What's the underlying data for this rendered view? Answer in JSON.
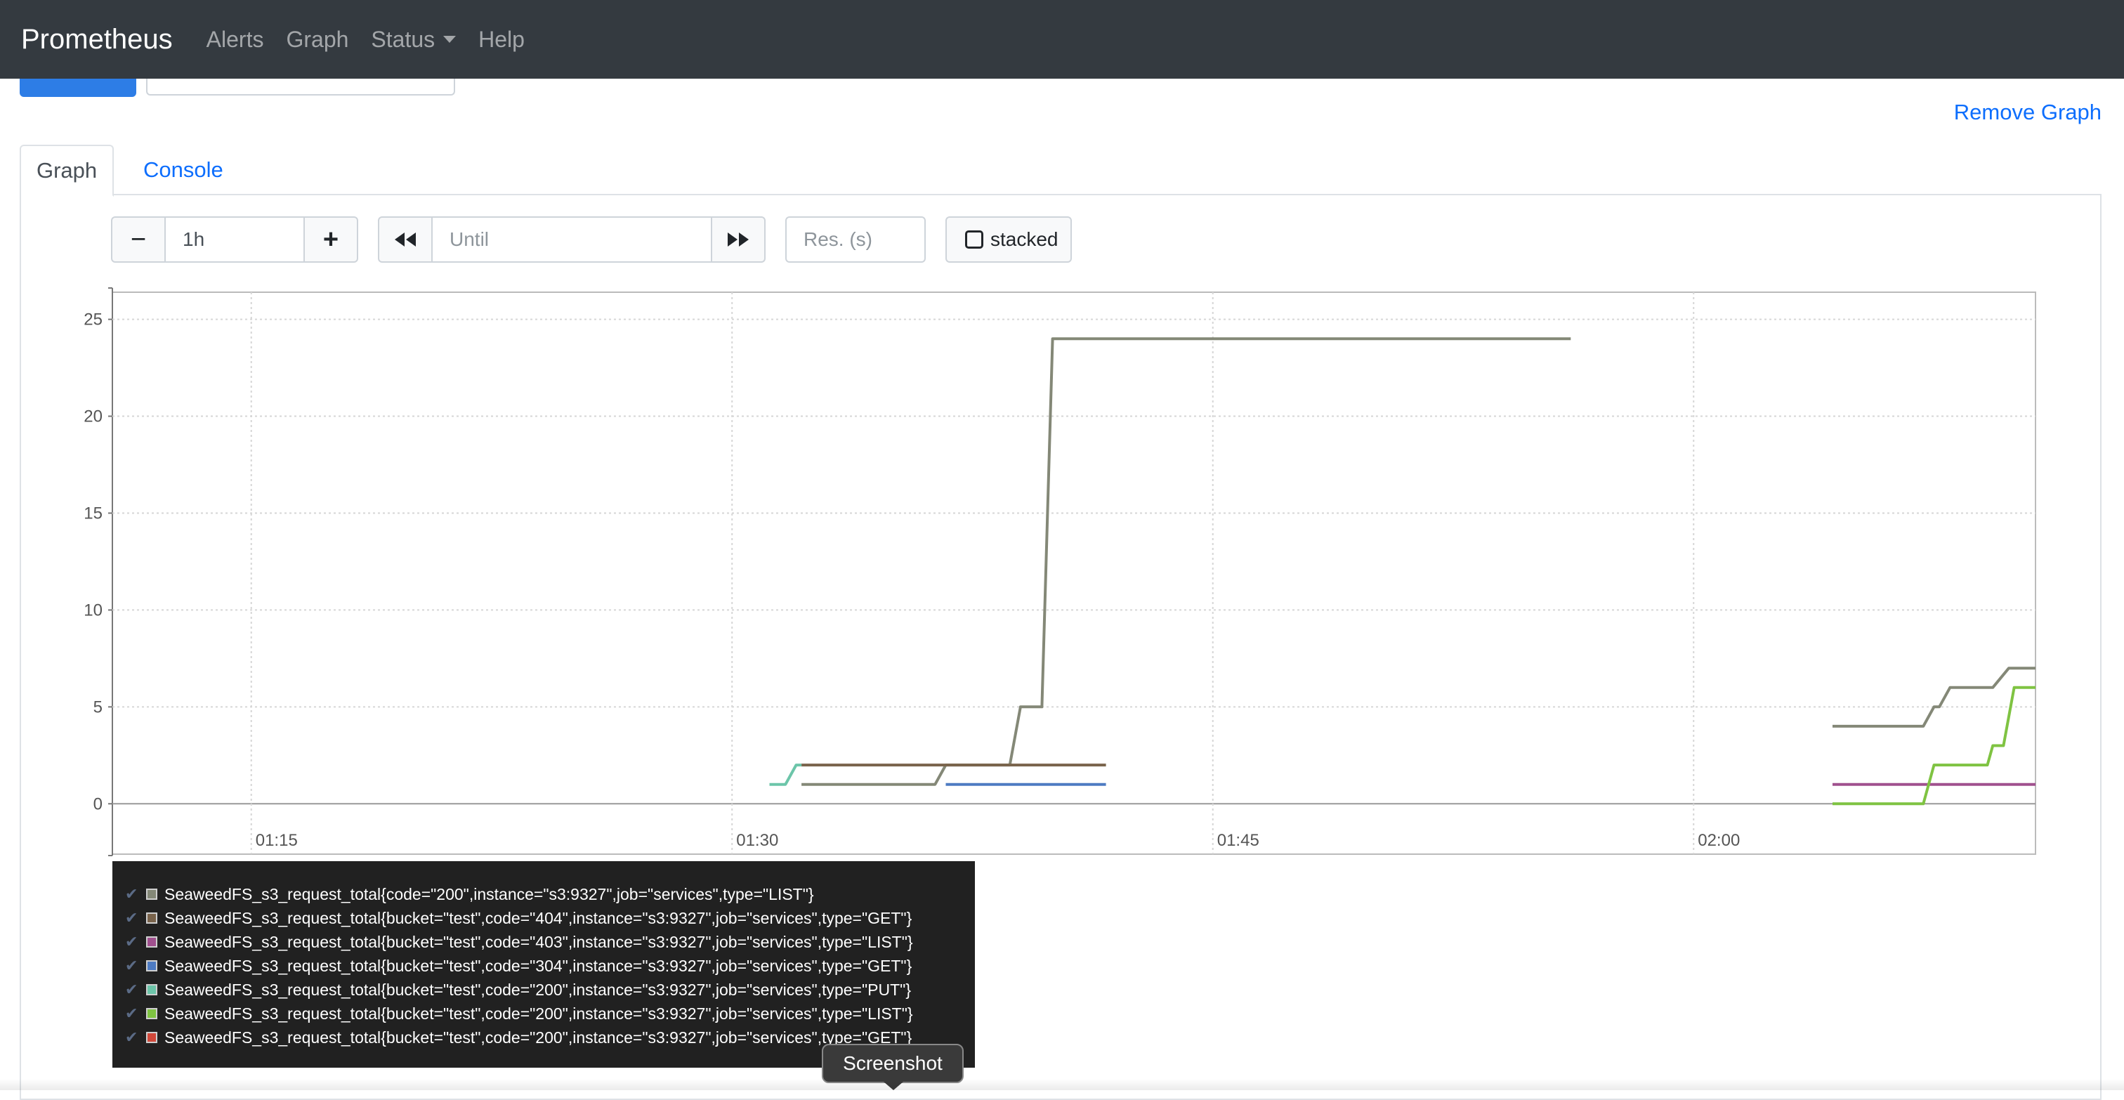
{
  "navbar": {
    "brand": "Prometheus",
    "items": [
      {
        "label": "Alerts"
      },
      {
        "label": "Graph"
      },
      {
        "label": "Status"
      },
      {
        "label": "Help"
      }
    ]
  },
  "panel": {
    "remove_graph": "Remove Graph",
    "tabs": [
      {
        "label": "Graph"
      },
      {
        "label": "Console"
      }
    ]
  },
  "controls": {
    "range_minus": "−",
    "range_value": "1h",
    "range_plus": "+",
    "back": "◀◀",
    "until_placeholder": "Until",
    "forward": "▶▶",
    "res_placeholder": "Res. (s)",
    "stacked_label": "stacked"
  },
  "chart_data": {
    "type": "line",
    "ylim": [
      -2.6,
      26.4
    ],
    "yticks": [
      0,
      5,
      10,
      15,
      20,
      25
    ],
    "xlim": [
      "01:10:40",
      "02:10:40"
    ],
    "xticks": [
      {
        "t": "01:15:00",
        "label": "01:15"
      },
      {
        "t": "01:30:00",
        "label": "01:30"
      },
      {
        "t": "01:45:00",
        "label": "01:45"
      },
      {
        "t": "02:00:00",
        "label": "02:00"
      }
    ],
    "series": [
      {
        "name": "SeaweedFS_s3_request_total{code=\"200\",instance=\"s3:9327\",job=\"services\",type=\"LIST\"}",
        "color": "#848877",
        "points": [
          [
            "01:32:10",
            1
          ],
          [
            "01:36:20",
            1
          ],
          [
            "01:36:40",
            2
          ],
          [
            "01:38:40",
            2
          ],
          [
            "01:39:00",
            5
          ],
          [
            "01:39:40",
            5
          ],
          [
            "01:40:00",
            24
          ],
          [
            "01:56:10",
            24
          ],
          null,
          [
            "02:04:20",
            4
          ],
          [
            "02:07:10",
            4
          ],
          [
            "02:07:30",
            5
          ],
          [
            "02:07:40",
            5
          ],
          [
            "02:08:00",
            6
          ],
          [
            "02:09:20",
            6
          ],
          [
            "02:09:50",
            7
          ],
          [
            "02:12:10",
            7
          ],
          [
            "02:12:40",
            8
          ]
        ]
      },
      {
        "name": "SeaweedFS_s3_request_total{bucket=\"test\",code=\"404\",instance=\"s3:9327\",job=\"services\",type=\"GET\"}",
        "color": "#79634b",
        "points": [
          [
            "01:32:10",
            2
          ],
          [
            "01:41:40",
            2
          ]
        ]
      },
      {
        "name": "SeaweedFS_s3_request_total{bucket=\"test\",code=\"403\",instance=\"s3:9327\",job=\"services\",type=\"LIST\"}",
        "color": "#a0508e",
        "points": [
          [
            "02:04:20",
            1
          ],
          [
            "02:10:40",
            1
          ]
        ]
      },
      {
        "name": "SeaweedFS_s3_request_total{bucket=\"test\",code=\"304\",instance=\"s3:9327\",job=\"services\",type=\"GET\"}",
        "color": "#4e7bc2",
        "points": [
          [
            "01:36:40",
            1
          ],
          [
            "01:41:40",
            1
          ]
        ]
      },
      {
        "name": "SeaweedFS_s3_request_total{bucket=\"test\",code=\"200\",instance=\"s3:9327\",job=\"services\",type=\"PUT\"}",
        "color": "#6cc5a9",
        "points": [
          [
            "01:31:10",
            1
          ],
          [
            "01:31:40",
            1
          ],
          [
            "01:32:00",
            2
          ],
          [
            "01:32:10",
            2
          ]
        ]
      },
      {
        "name": "SeaweedFS_s3_request_total{bucket=\"test\",code=\"200\",instance=\"s3:9327\",job=\"services\",type=\"LIST\"}",
        "color": "#7fc342",
        "points": [
          [
            "02:04:20",
            0
          ],
          [
            "02:07:10",
            0
          ],
          [
            "02:07:30",
            2
          ],
          [
            "02:09:10",
            2
          ],
          [
            "02:09:20",
            3
          ],
          [
            "02:09:40",
            3
          ],
          [
            "02:10:00",
            6
          ],
          [
            "02:12:10",
            6
          ]
        ]
      },
      {
        "name": "SeaweedFS_s3_request_total{bucket=\"test\",code=\"200\",instance=\"s3:9327\",job=\"services\",type=\"GET\"}",
        "color": "#d0483a",
        "points": []
      }
    ]
  },
  "tooltip": {
    "text": "Screenshot"
  }
}
